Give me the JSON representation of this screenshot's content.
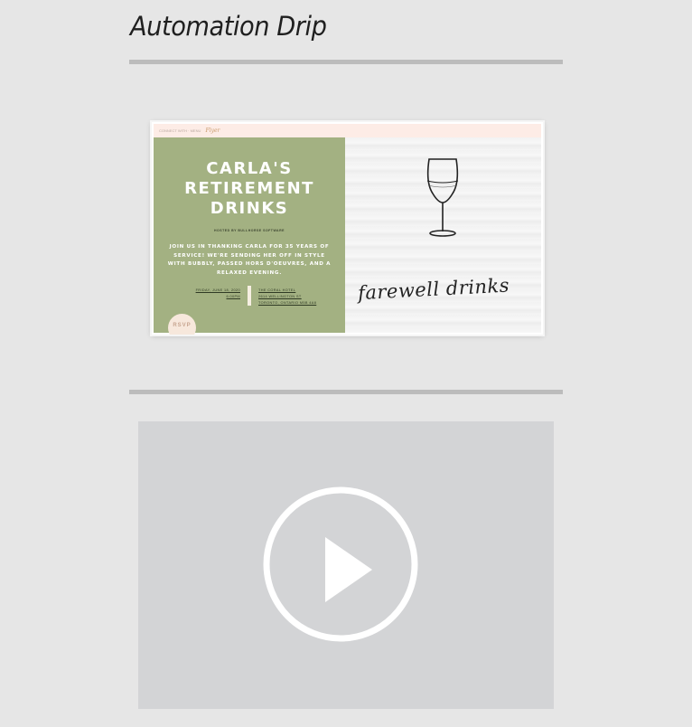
{
  "page": {
    "title": "Automation Drip"
  },
  "email_preview": {
    "topbar_text": "CONNECT WITH · MENU",
    "brand": "Flyer",
    "headline_line1": "CARLA'S",
    "headline_line2": "RETIREMENT",
    "headline_line3": "DRINKS",
    "hosted_by": "HOSTED BY BULLHORSE SOFTWARE",
    "body": "JOIN US IN THANKING CARLA FOR 35 YEARS OF SERVICE! WE'RE SENDING HER OFF IN STYLE WITH BUBBLY, PASSED HORS D'OEUVRES, AND A RELAXED EVENING.",
    "date_line1": "FRIDAY, JUNE 18, 2020",
    "date_line2": "6:00PM",
    "address_line1": "THE CORAL HOTEL",
    "address_line2": "2614 WELLINGTON ST",
    "address_line3": "TORONTO, ONTARIO M5B 4A8",
    "rsvp": "RSVP",
    "script_text": "farewell drinks",
    "colors": {
      "panel_green": "#a3b182",
      "topbar": "#fdece6"
    }
  },
  "video": {
    "play_icon": "play-circle-icon",
    "background": "#d3d4d6"
  }
}
